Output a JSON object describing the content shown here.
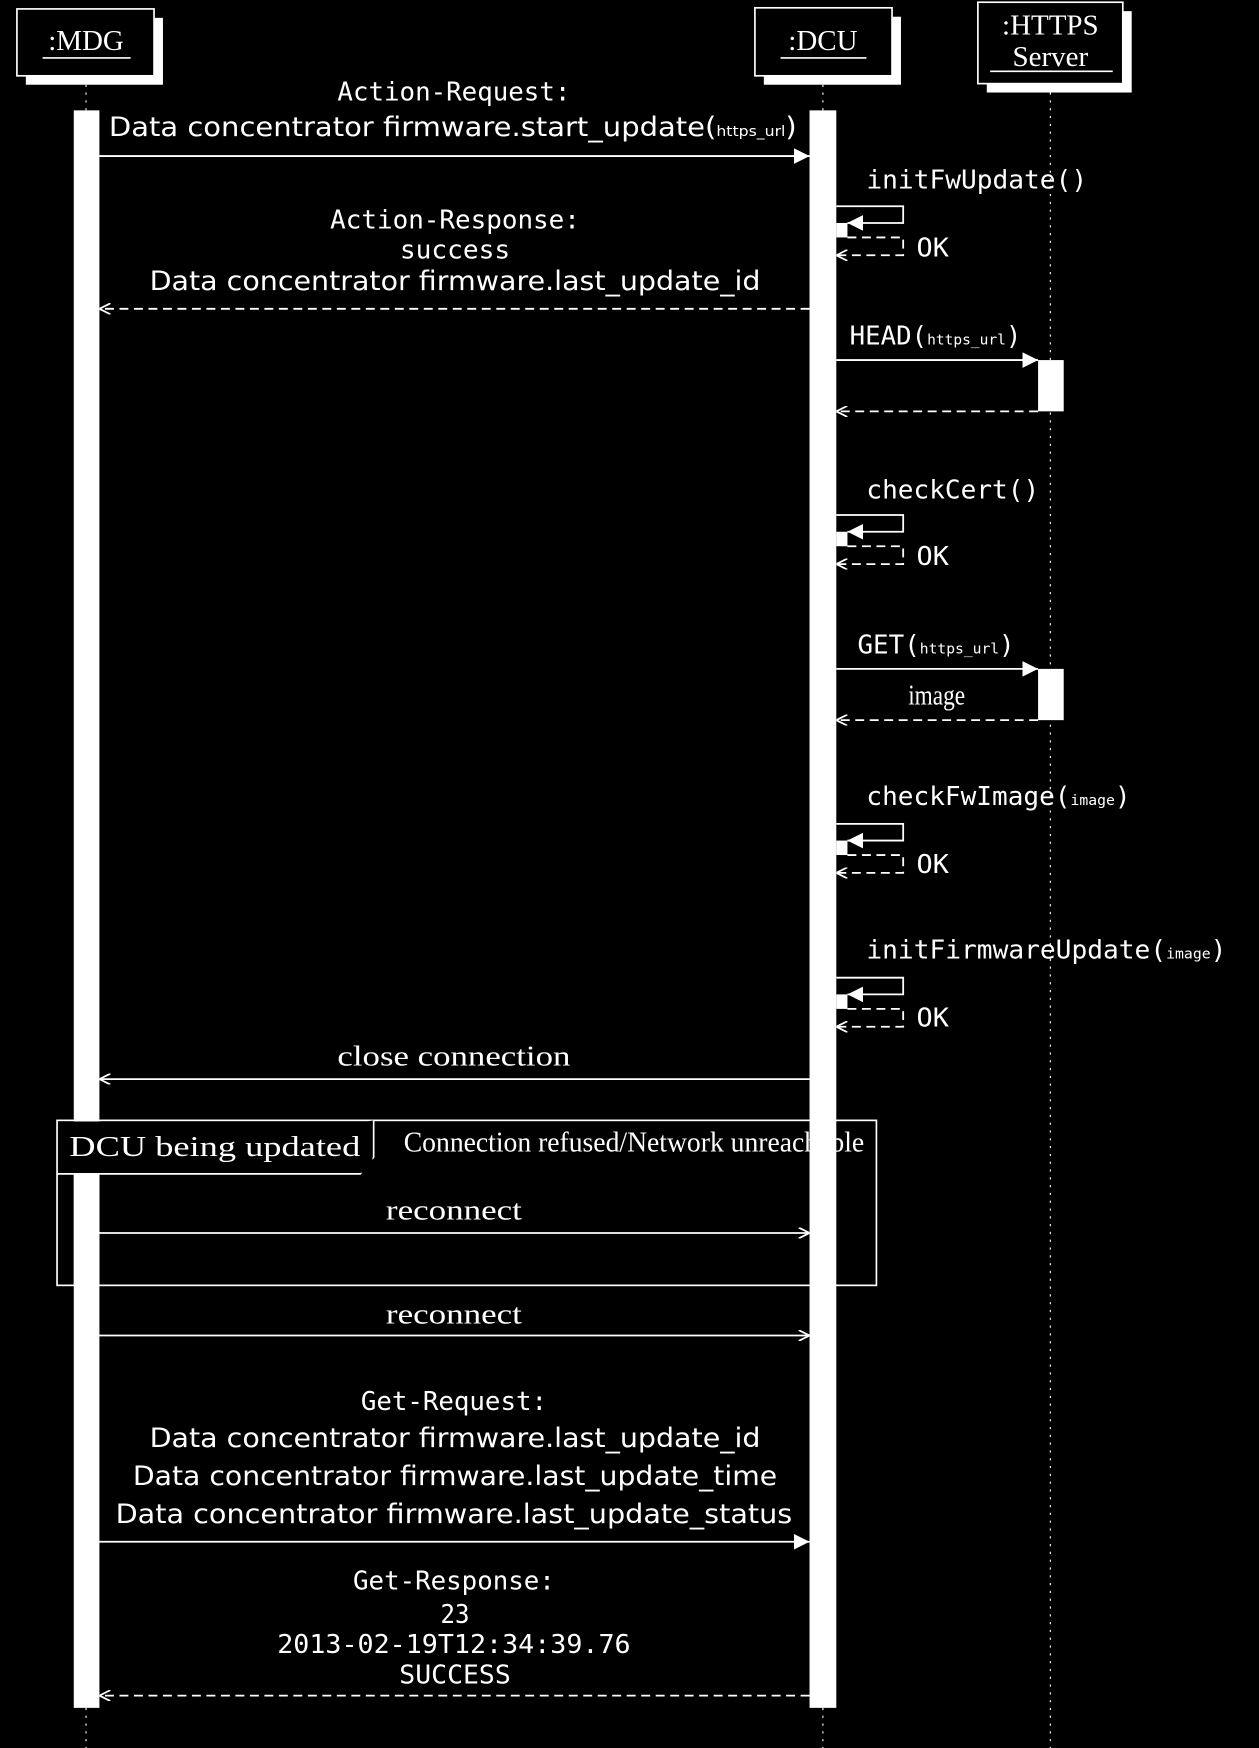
{
  "colors": {
    "background": "#000000",
    "foreground": "#ffffff"
  },
  "participants": {
    "mdg": {
      "label": ":MDG"
    },
    "dcu": {
      "label": ":DCU"
    },
    "https": {
      "line1": ":HTTPS",
      "line2": "Server"
    }
  },
  "messages": {
    "action_request": {
      "line1": "Action-Request:",
      "prefix": "Data concentrator firmware.start_update(",
      "arg": "https_url",
      "suffix": ")"
    },
    "init_fw_update": {
      "label": "initFwUpdate()",
      "reply": "OK"
    },
    "action_response": {
      "line1": "Action-Response:",
      "line2": "success",
      "line3": "Data concentrator firmware.last_update_id"
    },
    "head": {
      "prefix": "HEAD(",
      "arg": "https_url",
      "suffix": ")"
    },
    "check_cert": {
      "label": "checkCert()",
      "reply": "OK"
    },
    "get": {
      "prefix": "GET(",
      "arg": "https_url",
      "suffix": ")",
      "reply": "image"
    },
    "check_fw_image": {
      "prefix": "checkFwImage(",
      "arg": "image",
      "suffix": ")",
      "reply": "OK"
    },
    "init_firmware_update": {
      "prefix": "initFirmwareUpdate(",
      "arg": "image",
      "suffix": ")",
      "reply": "OK"
    },
    "close_connection": {
      "label": "close connection"
    },
    "frame": {
      "title": "DCU being updated",
      "guard": "Connection refused/Network unreachable"
    },
    "reconnect_1": {
      "label": "reconnect"
    },
    "reconnect_2": {
      "label": "reconnect"
    },
    "get_request": {
      "line1": "Get-Request:",
      "line2": "Data concentrator firmware.last_update_id",
      "line3": "Data concentrator firmware.last_update_time",
      "line4": "Data concentrator firmware.last_update_status"
    },
    "get_response": {
      "line1": "Get-Response:",
      "line2": "23",
      "line3": "2013-02-19T12:34:39.76",
      "line4": "SUCCESS"
    }
  }
}
